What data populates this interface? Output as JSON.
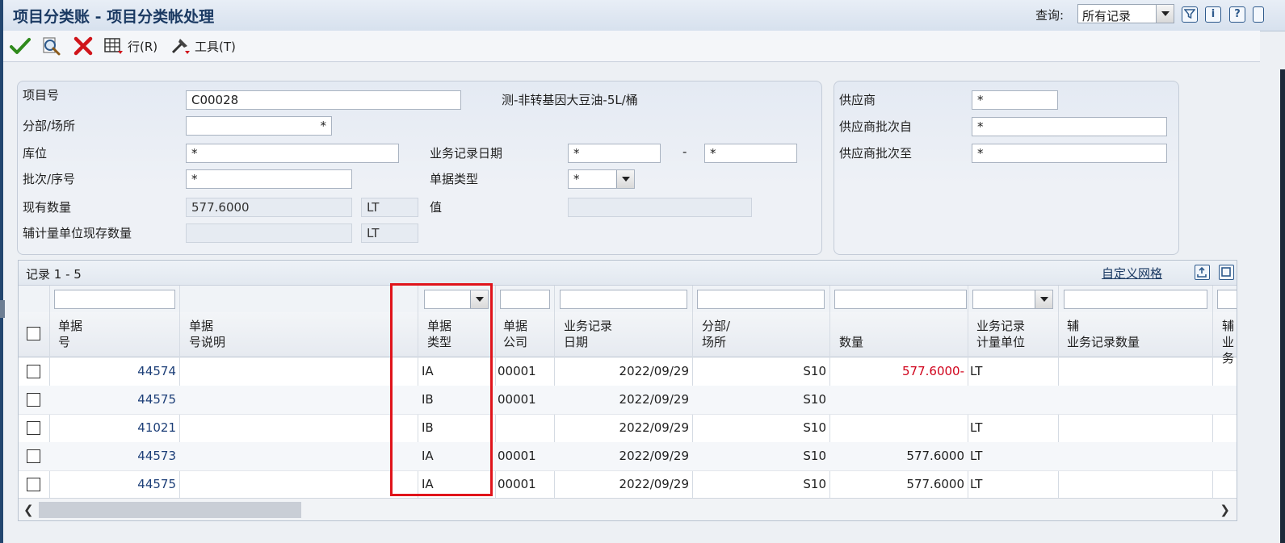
{
  "window": {
    "title": "项目分类账 - 项目分类帐处理",
    "query_label": "查询:",
    "query_value": "所有记录"
  },
  "toolbar": {
    "row_menu": "行(R)",
    "tools_menu": "工具(T)"
  },
  "form": {
    "item_label": "项目号",
    "item_value": "C00028",
    "item_desc": "测-非转基因大豆油-5L/桶",
    "branch_label": "分部/场所",
    "branch_value": "*",
    "location_label": "库位",
    "location_value": "*",
    "lot_label": "批次/序号",
    "lot_value": "*",
    "onhand_label": "现有数量",
    "onhand_value": "577.6000",
    "onhand_uom": "LT",
    "secondary_label": "辅计量单位现存数量",
    "secondary_value": "",
    "secondary_uom": "LT",
    "trans_date_label": "业务记录日期",
    "trans_date_from": "*",
    "trans_date_sep": "-",
    "trans_date_to": "*",
    "doc_type_label": "单据类型",
    "doc_type_value": "*",
    "value_label": "值",
    "value_value": "",
    "supplier_label": "供应商",
    "supplier_value": "*",
    "supplier_lot_from_label": "供应商批次自",
    "supplier_lot_from_value": "*",
    "supplier_lot_to_label": "供应商批次至",
    "supplier_lot_to_value": "*"
  },
  "grid": {
    "record_count": "记录 1 - 5",
    "custom_grid": "自定义网格",
    "columns": {
      "doc_no_1": "单据",
      "doc_no_2": "号",
      "doc_desc_1": "单据",
      "doc_desc_2": "号说明",
      "doc_type_1": "单据",
      "doc_type_2": "类型",
      "doc_co_1": "单据",
      "doc_co_2": "公司",
      "trans_date_1": "业务记录",
      "trans_date_2": "日期",
      "branch_1": "分部/",
      "branch_2": "场所",
      "qty": "数量",
      "uom_1": "业务记录",
      "uom_2": "计量单位",
      "sec_1": "辅",
      "sec_2": "业务记录数量",
      "sec2_1": "辅",
      "sec2_2": "业务"
    },
    "rows": [
      {
        "doc_no": "44574",
        "doc_type": "IA",
        "doc_co": "00001",
        "date": "2022/09/29",
        "branch": "S10",
        "qty": "577.6000-",
        "uom": "LT"
      },
      {
        "doc_no": "44575",
        "doc_type": "IB",
        "doc_co": "00001",
        "date": "2022/09/29",
        "branch": "S10",
        "qty": "",
        "uom": ""
      },
      {
        "doc_no": "41021",
        "doc_type": "IB",
        "doc_co": "",
        "date": "2022/09/29",
        "branch": "S10",
        "qty": "",
        "uom": "LT"
      },
      {
        "doc_no": "44573",
        "doc_type": "IA",
        "doc_co": "00001",
        "date": "2022/09/29",
        "branch": "S10",
        "qty": "577.6000",
        "uom": "LT"
      },
      {
        "doc_no": "44575",
        "doc_type": "IA",
        "doc_co": "00001",
        "date": "2022/09/29",
        "branch": "S10",
        "qty": "577.6000",
        "uom": "LT"
      }
    ]
  },
  "colors": {
    "title": "#1b3a63",
    "link": "#1d3f78",
    "negative": "#d0021b",
    "highlight": "#e0141b"
  }
}
